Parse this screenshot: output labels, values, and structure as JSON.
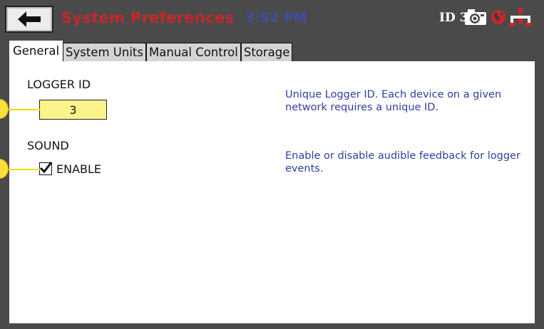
{
  "header": {
    "title": "System Preferences",
    "time": "3:52 PM",
    "id_label": "ID 3",
    "icons": [
      "back-arrow-icon",
      "camera-icon",
      "globe-icon",
      "network-icon"
    ]
  },
  "tabs": [
    {
      "label": "General",
      "active": true
    },
    {
      "label": "System Units",
      "active": false
    },
    {
      "label": "Manual Control",
      "active": false
    },
    {
      "label": "Storage",
      "active": false
    }
  ],
  "general": {
    "logger_id": {
      "title": "LOGGER ID",
      "value": "3",
      "description": "Unique Logger ID.  Each device on a given network requires a unique ID."
    },
    "sound": {
      "title": "SOUND",
      "enable_label": "ENABLE",
      "enabled": true,
      "description": "Enable or disable audible feedback for logger events."
    }
  },
  "colors": {
    "title_red": "#c8262b",
    "time_blue": "#3c4fa8",
    "description_blue": "#2e3ea0",
    "input_yellow": "#fbf48c",
    "callout_yellow": "#fbe03a",
    "header_gray": "#4a4a4a"
  }
}
